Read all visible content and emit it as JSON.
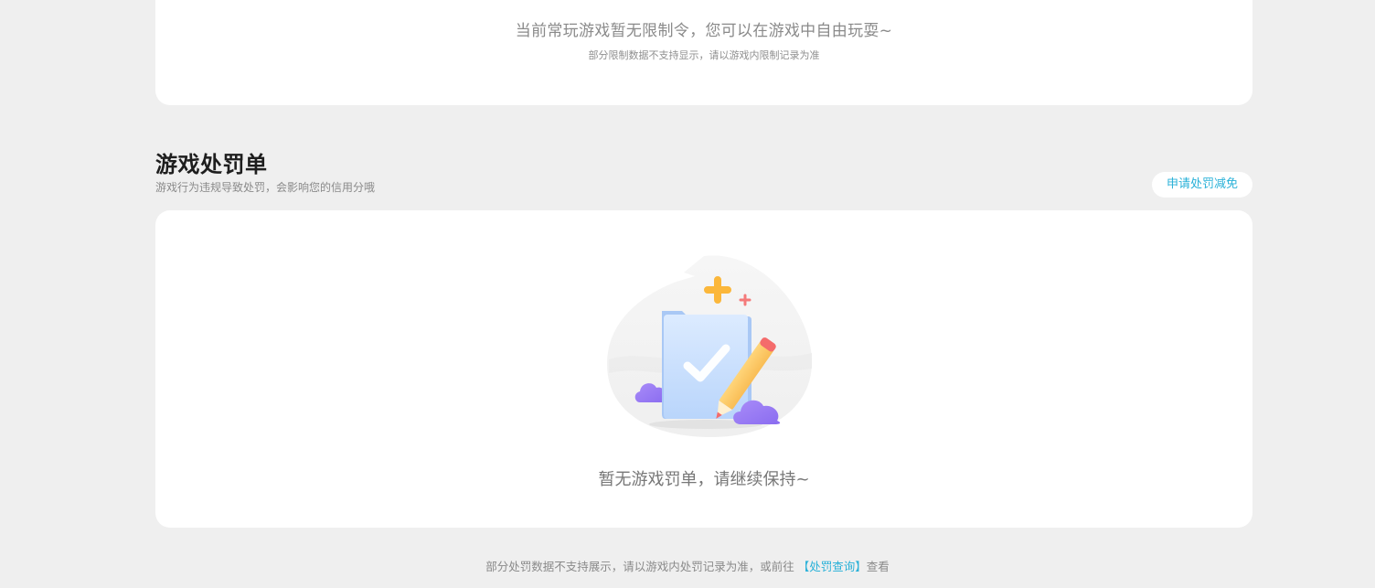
{
  "limits_card": {
    "message": "当前常玩游戏暂无限制令，您可以在游戏中自由玩耍~",
    "note": "部分限制数据不支持显示，请以游戏内限制记录为准"
  },
  "penalty_section": {
    "title": "游戏处罚单",
    "subtitle": "游戏行为违规导致处罚，会影响您的信用分哦",
    "appeal_button": "申请处罚减免",
    "empty_message": "暂无游戏罚单，请继续保持~"
  },
  "footer": {
    "prefix": "部分处罚数据不支持展示，请以游戏内处罚记录为准，或前往",
    "link": "【处罚查询】",
    "suffix": "查看"
  },
  "colors": {
    "background": "#efefef",
    "card": "#ffffff",
    "accent": "#29b1d8",
    "title": "#1e1e1e",
    "muted": "#8a8a8a"
  }
}
